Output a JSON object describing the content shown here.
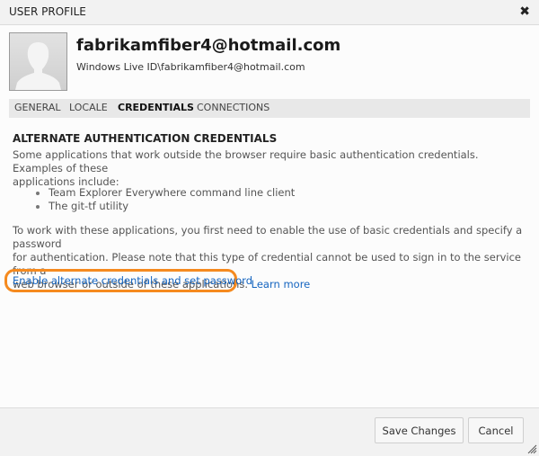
{
  "dialog": {
    "title": "USER PROFILE",
    "close_icon": "close-icon"
  },
  "profile": {
    "display_name": "fabrikamfiber4@hotmail.com",
    "account_id": "Windows Live ID\\fabrikamfiber4@hotmail.com",
    "avatar_icon": "user-silhouette-icon"
  },
  "tabs": [
    {
      "label": "GENERAL",
      "active": false
    },
    {
      "label": "LOCALE",
      "active": false
    },
    {
      "label": "CREDENTIALS",
      "active": true
    },
    {
      "label": "CONNECTIONS",
      "active": false
    }
  ],
  "content": {
    "section_title": "ALTERNATE AUTHENTICATION CREDENTIALS",
    "intro_line1": "Some applications that work outside the browser require basic authentication credentials. Examples of these",
    "intro_line2": "applications include:",
    "examples": [
      "Team Explorer Everywhere command line client",
      "The git-tf utility"
    ],
    "note_line1": "To work with these applications, you first need to enable the use of basic credentials and specify a password",
    "note_line2": "for authentication. Please note that this type of credential cannot be used to sign in to the service from a",
    "note_line3": "web browser or outside of these applications.",
    "learn_more_label": "Learn more",
    "enable_link_label": "Enable alternate credentials and set password",
    "highlight_color": "#f58a1f",
    "link_color": "#1565c0"
  },
  "footer": {
    "save_label": "Save Changes",
    "cancel_label": "Cancel"
  }
}
